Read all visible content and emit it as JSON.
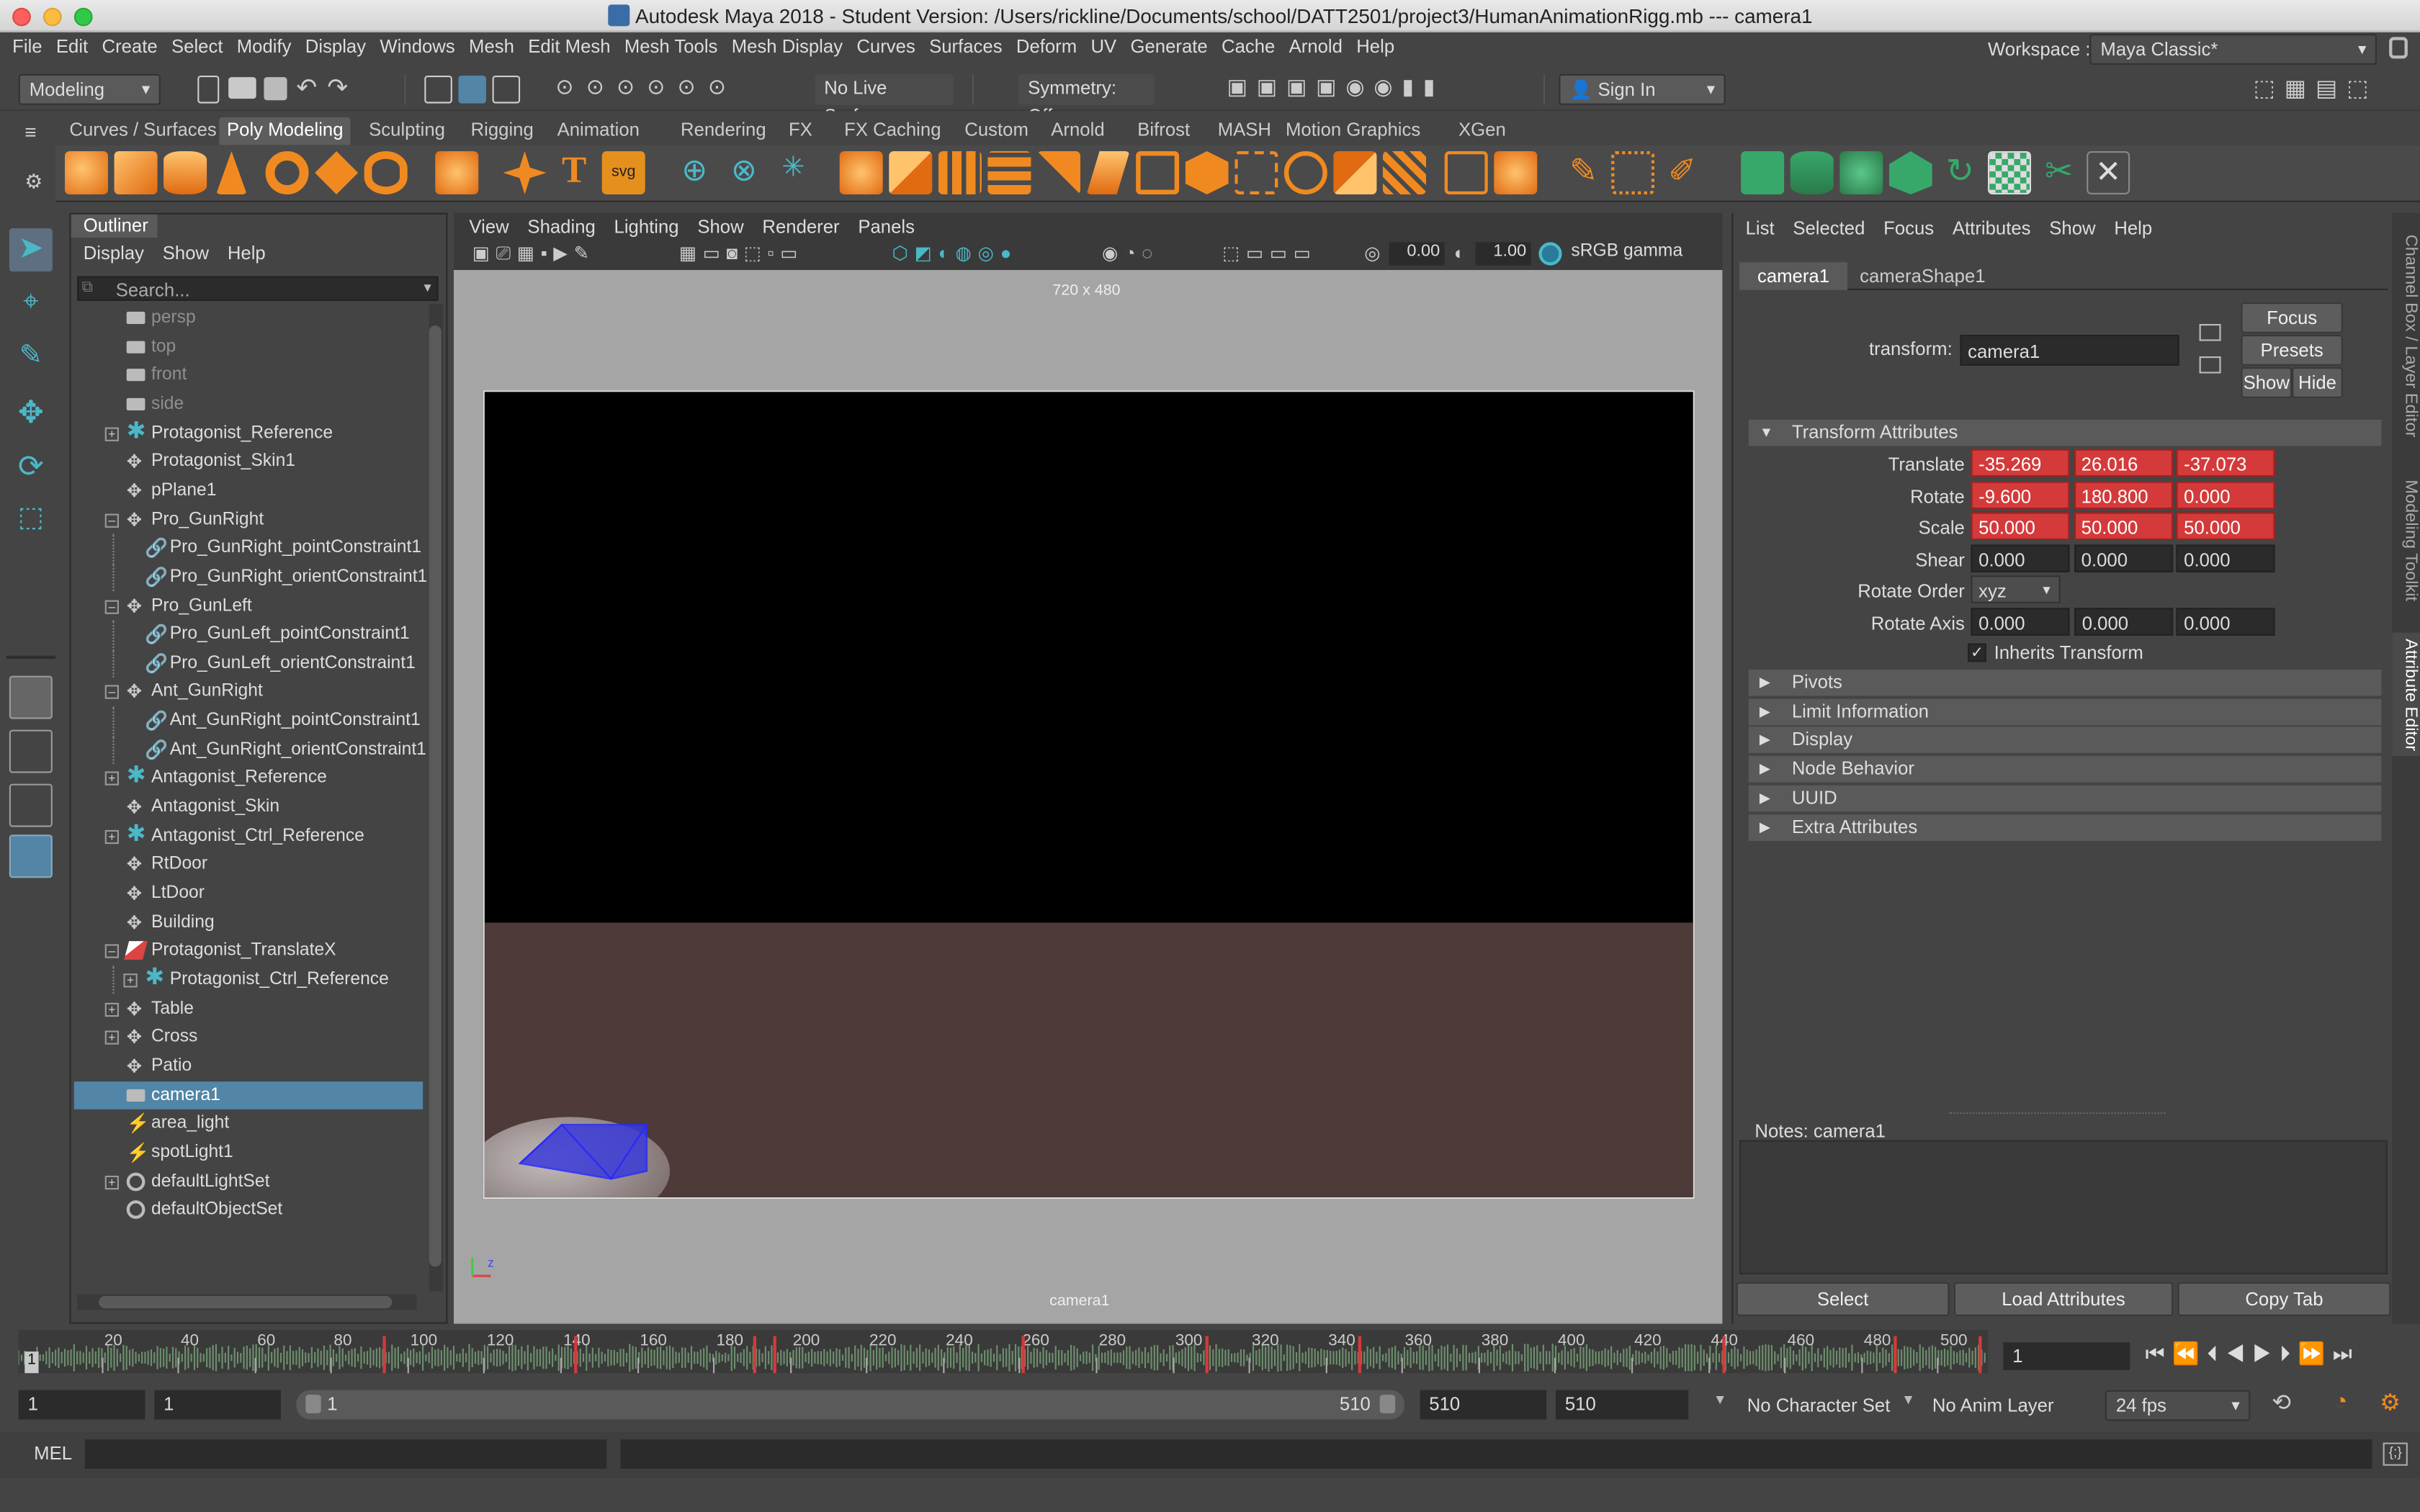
{
  "window": {
    "title": "Autodesk Maya 2018 - Student Version: /Users/rickline/Documents/school/DATT2501/project3/HumanAnimationRigg.mb  ---   camera1"
  },
  "menus": [
    "File",
    "Edit",
    "Create",
    "Select",
    "Modify",
    "Display",
    "Windows",
    "Mesh",
    "Edit Mesh",
    "Mesh Tools",
    "Mesh Display",
    "Curves",
    "Surfaces",
    "Deform",
    "UV",
    "Generate",
    "Cache",
    "Arnold",
    "Help"
  ],
  "workspace": {
    "label": "Workspace :",
    "value": "Maya Classic*"
  },
  "statusline": {
    "mode": "Modeling",
    "live_surface": "No Live Surface",
    "symmetry": "Symmetry: Off",
    "sign_in": "Sign In"
  },
  "shelf_tabs": [
    "Curves / Surfaces",
    "Poly Modeling",
    "Sculpting",
    "Rigging",
    "Animation",
    "Rendering",
    "FX",
    "FX Caching",
    "Custom",
    "Arnold",
    "Bifrost",
    "MASH",
    "Motion Graphics",
    "XGen"
  ],
  "shelf_active": "Poly Modeling",
  "outliner": {
    "title": "Outliner",
    "menus": [
      "Display",
      "Show",
      "Help"
    ],
    "search_placeholder": "Search...",
    "items": [
      {
        "label": "persp",
        "indent": 0,
        "exp": "",
        "icon": "camera",
        "dim": true
      },
      {
        "label": "top",
        "indent": 0,
        "exp": "",
        "icon": "camera",
        "dim": true
      },
      {
        "label": "front",
        "indent": 0,
        "exp": "",
        "icon": "camera",
        "dim": true
      },
      {
        "label": "side",
        "indent": 0,
        "exp": "",
        "icon": "camera",
        "dim": true
      },
      {
        "label": "Protagonist_Reference",
        "indent": 0,
        "exp": "+",
        "icon": "star"
      },
      {
        "label": "Protagonist_Skin1",
        "indent": 0,
        "exp": "",
        "icon": "transform"
      },
      {
        "label": "pPlane1",
        "indent": 0,
        "exp": "",
        "icon": "transform"
      },
      {
        "label": "Pro_GunRight",
        "indent": 0,
        "exp": "-",
        "icon": "transform"
      },
      {
        "label": "Pro_GunRight_pointConstraint1",
        "indent": 1,
        "exp": "",
        "icon": "constraint"
      },
      {
        "label": "Pro_GunRight_orientConstraint1",
        "indent": 1,
        "exp": "",
        "icon": "constraint"
      },
      {
        "label": "Pro_GunLeft",
        "indent": 0,
        "exp": "-",
        "icon": "transform"
      },
      {
        "label": "Pro_GunLeft_pointConstraint1",
        "indent": 1,
        "exp": "",
        "icon": "constraint"
      },
      {
        "label": "Pro_GunLeft_orientConstraint1",
        "indent": 1,
        "exp": "",
        "icon": "constraint"
      },
      {
        "label": "Ant_GunRight",
        "indent": 0,
        "exp": "-",
        "icon": "transform"
      },
      {
        "label": "Ant_GunRight_pointConstraint1",
        "indent": 1,
        "exp": "",
        "icon": "constraint"
      },
      {
        "label": "Ant_GunRight_orientConstraint1",
        "indent": 1,
        "exp": "",
        "icon": "constraint"
      },
      {
        "label": "Antagonist_Reference",
        "indent": 0,
        "exp": "+",
        "icon": "star"
      },
      {
        "label": "Antagonist_Skin",
        "indent": 0,
        "exp": "",
        "icon": "transform"
      },
      {
        "label": "Antagonist_Ctrl_Reference",
        "indent": 0,
        "exp": "+",
        "icon": "star"
      },
      {
        "label": "RtDoor",
        "indent": 0,
        "exp": "",
        "icon": "transform"
      },
      {
        "label": "LtDoor",
        "indent": 0,
        "exp": "",
        "icon": "transform"
      },
      {
        "label": "Building",
        "indent": 0,
        "exp": "",
        "icon": "transform"
      },
      {
        "label": "Protagonist_TranslateX",
        "indent": 0,
        "exp": "-",
        "icon": "curve"
      },
      {
        "label": "Protagonist_Ctrl_Reference",
        "indent": 1,
        "exp": "+",
        "icon": "star"
      },
      {
        "label": "Table",
        "indent": 0,
        "exp": "+",
        "icon": "transform"
      },
      {
        "label": "Cross",
        "indent": 0,
        "exp": "+",
        "icon": "transform"
      },
      {
        "label": "Patio",
        "indent": 0,
        "exp": "",
        "icon": "transform"
      },
      {
        "label": "camera1",
        "indent": 0,
        "exp": "",
        "icon": "camera",
        "selected": true
      },
      {
        "label": "area_light",
        "indent": 0,
        "exp": "",
        "icon": "light"
      },
      {
        "label": "spotLight1",
        "indent": 0,
        "exp": "",
        "icon": "light"
      },
      {
        "label": "defaultLightSet",
        "indent": 0,
        "exp": "+",
        "icon": "set"
      },
      {
        "label": "defaultObjectSet",
        "indent": 0,
        "exp": "",
        "icon": "set"
      }
    ]
  },
  "viewport": {
    "menus": [
      "View",
      "Shading",
      "Lighting",
      "Show",
      "Renderer",
      "Panels"
    ],
    "exposure": "0.00",
    "gamma": "1.00",
    "color_space": "sRGB gamma",
    "resolution": "720 x 480",
    "camera_label": "camera1"
  },
  "attribute_editor": {
    "menus": [
      "List",
      "Selected",
      "Focus",
      "Attributes",
      "Show",
      "Help"
    ],
    "tabs": [
      "camera1",
      "cameraShape1"
    ],
    "transform_label": "transform:",
    "transform_value": "camera1",
    "buttons": {
      "focus": "Focus",
      "presets": "Presets",
      "show": "Show",
      "hide": "Hide"
    },
    "section": "Transform Attributes",
    "rows": [
      {
        "label": "Translate",
        "values": [
          "-35.269",
          "26.016",
          "-37.073"
        ],
        "red": true
      },
      {
        "label": "Rotate",
        "values": [
          "-9.600",
          "180.800",
          "0.000"
        ],
        "red": true
      },
      {
        "label": "Scale",
        "values": [
          "50.000",
          "50.000",
          "50.000"
        ],
        "red": true
      },
      {
        "label": "Shear",
        "values": [
          "0.000",
          "0.000",
          "0.000"
        ],
        "red": false
      }
    ],
    "rotate_order_label": "Rotate Order",
    "rotate_order": "xyz",
    "rotate_axis_label": "Rotate Axis",
    "rotate_axis": [
      "0.000",
      "0.000",
      "0.000"
    ],
    "inherits": "Inherits Transform",
    "collapsed_sections": [
      "Pivots",
      "Limit Information",
      "Display",
      "Node Behavior",
      "UUID",
      "Extra Attributes"
    ],
    "notes_label": "Notes:  camera1",
    "bottom_buttons": [
      "Select",
      "Load Attributes",
      "Copy Tab"
    ]
  },
  "side_tabs": [
    "Channel Box / Layer Editor",
    "Modeling Toolkit",
    "Attribute Editor"
  ],
  "timeline": {
    "ticks": [
      "20",
      "40",
      "60",
      "80",
      "100",
      "120",
      "140",
      "160",
      "180",
      "200",
      "220",
      "240",
      "260",
      "280",
      "300",
      "320",
      "340",
      "360",
      "380",
      "400",
      "420",
      "440",
      "460",
      "480",
      "500"
    ],
    "current_frame_marker": "1",
    "current_frame": "1"
  },
  "range": {
    "start": "1",
    "playback_start": "1",
    "slider_start": "1",
    "slider_end": "510",
    "playback_end": "510",
    "end": "510",
    "character_set": "No Character Set",
    "anim_layer": "No Anim Layer",
    "fps": "24 fps"
  },
  "command": {
    "label": "MEL"
  },
  "colors": {
    "selected": "#5285a6",
    "keyed": "#d43a3a",
    "accent": "#4bb8c8"
  }
}
